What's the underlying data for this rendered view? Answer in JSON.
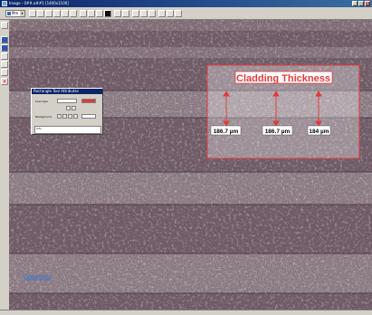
{
  "window": {
    "title": "Image - 0##.a##1 [1400x1100]"
  },
  "toolbar": {
    "zoom_label": "Mm"
  },
  "annotation": {
    "title": "Cladding Thickness",
    "measurements": [
      "186.7 µm",
      "186.7 µm",
      "184 µm"
    ],
    "box_color": "#e03a3a"
  },
  "dialog": {
    "title": "Rectangle Tool Attributes",
    "line_type_label": "Line type",
    "background_label": "Background",
    "info_label": "Info"
  },
  "colors": {
    "title_bar": "#0a246a",
    "accent_red": "#e03a3a"
  }
}
